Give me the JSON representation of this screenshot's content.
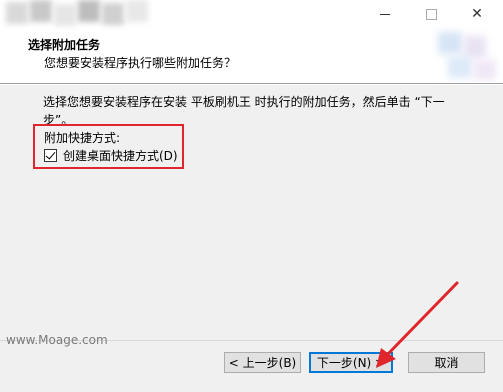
{
  "window": {
    "controls": {
      "minimize": "—",
      "maximize": "☐",
      "close": "✕"
    }
  },
  "header": {
    "title": "选择附加任务",
    "subtitle": "您想要安装程序执行哪些附加任务？"
  },
  "content": {
    "instruction": "选择您想要安装程序在安装 平板刷机王 时执行的附加任务，然后单击 “下一步”。",
    "group_label": "附加快捷方式:",
    "checkbox": {
      "label": "创建桌面快捷方式(D)",
      "checked": true
    }
  },
  "watermark": "www.Moage.com",
  "buttons": {
    "back": "< 上一步(B)",
    "next": "下一步(N) >",
    "cancel": "取消"
  },
  "colors": {
    "annotation_red": "#e0262a",
    "focus_blue": "#0078d7"
  }
}
